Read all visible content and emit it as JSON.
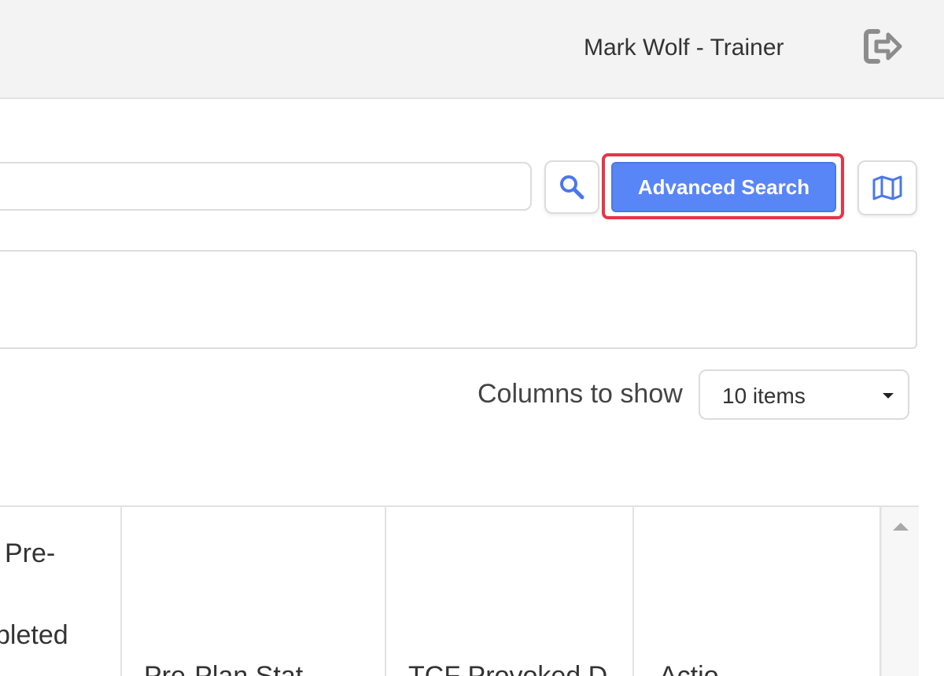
{
  "header": {
    "user_label": "Mark Wolf - Trainer"
  },
  "toolbar": {
    "search_value": "",
    "advanced_search_label": "Advanced Search",
    "highlight_color": "#e63547",
    "primary_color": "#5886f6"
  },
  "columns": {
    "label": "Columns to show",
    "selected": "10 items"
  },
  "table": {
    "headers": [
      {
        "line1": "Pre-",
        "line2": "pleted"
      },
      {
        "line1": "",
        "line2": "",
        "bottom": "Pre-Plan Stat"
      },
      {
        "line1": "",
        "line2": "",
        "bottom": "TCF Provoked D"
      },
      {
        "line1": "",
        "line2": "",
        "bottom": "Actio"
      }
    ]
  }
}
